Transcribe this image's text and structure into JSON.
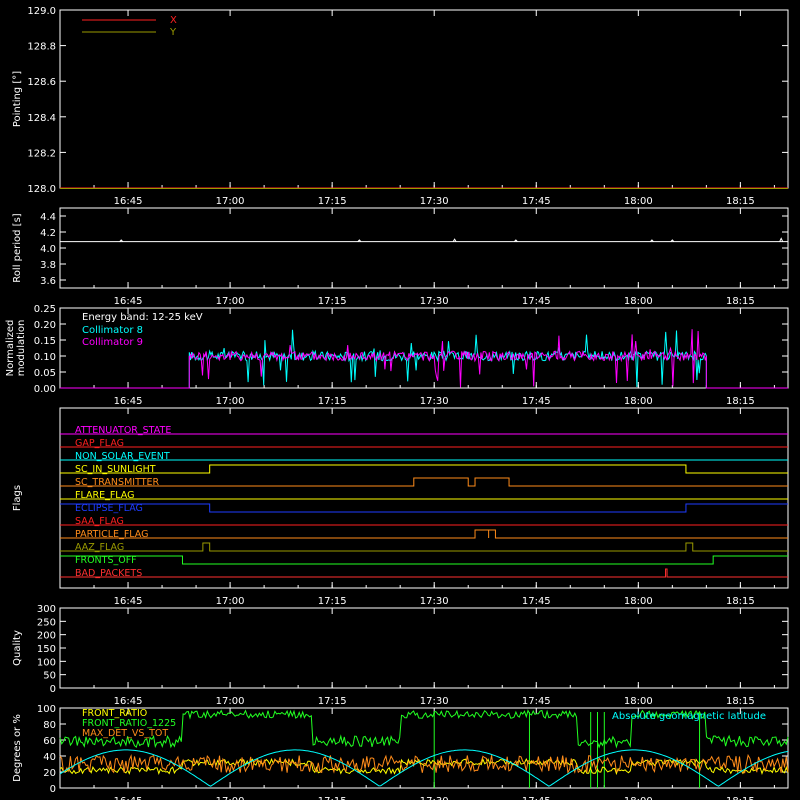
{
  "colors": {
    "background": "#000000",
    "axis": "#ffffff",
    "red": "#ff2020",
    "olive": "#9a9a00",
    "cyan": "#00ffff",
    "magenta": "#ff00ff",
    "yellow": "#ffff00",
    "orange": "#ff8c1a",
    "blue": "#1e3cff",
    "green": "#22ff22",
    "dark_red": "#ff3030"
  },
  "time_axis": {
    "start": "16:35",
    "end": "18:22",
    "ticks": [
      "16:45",
      "17:00",
      "17:15",
      "17:30",
      "17:45",
      "18:00",
      "18:15"
    ]
  },
  "chart_data": [
    {
      "type": "line",
      "id": "pointing",
      "ylabel": "Pointing [°]",
      "ylim": [
        128.0,
        129.0
      ],
      "yticks": [
        "128.0",
        "128.2",
        "128.4",
        "128.6",
        "128.8",
        "129.0"
      ],
      "legend_position": "top-left",
      "series": [
        {
          "name": "X",
          "color": "#ff2020",
          "constant": 128.0
        },
        {
          "name": "Y",
          "color": "#9a9a00",
          "constant": 128.0
        }
      ]
    },
    {
      "type": "line",
      "id": "roll",
      "ylabel": "Roll period [s]",
      "ylim": [
        3.5,
        4.5
      ],
      "yticks": [
        "3.6",
        "3.8",
        "4.0",
        "4.2",
        "4.4"
      ],
      "series": [
        {
          "name": "",
          "color": "#ffffff",
          "constant": 4.08,
          "blips": [
            [
              "16:44",
              4.1
            ],
            [
              "17:19",
              4.1
            ],
            [
              "17:33",
              4.11
            ],
            [
              "17:42",
              4.1
            ],
            [
              "18:02",
              4.1
            ],
            [
              "18:05",
              4.1
            ],
            [
              "18:21",
              4.12
            ]
          ]
        }
      ]
    },
    {
      "type": "line",
      "id": "modulation",
      "ylabel": "Normalized modulation",
      "ylim": [
        0.0,
        0.25
      ],
      "yticks": [
        "0.00",
        "0.05",
        "0.10",
        "0.15",
        "0.20",
        "0.25"
      ],
      "legend_title": "Energy band: 12-25 keV",
      "legend_position": "top-left",
      "active_range": [
        "16:54",
        "18:10"
      ],
      "series": [
        {
          "name": "Collimator 8",
          "color": "#00ffff",
          "level": 0.1
        },
        {
          "name": "Collimator 9",
          "color": "#ff00ff",
          "level": 0.1
        }
      ]
    },
    {
      "type": "line",
      "id": "flags",
      "ylabel": "Flags",
      "rows": [
        {
          "name": "ATTENUATOR_STATE",
          "color": "#ff00ff",
          "segments": []
        },
        {
          "name": "GAP_FLAG",
          "color": "#ff2020",
          "segments": []
        },
        {
          "name": "NON_SOLAR_EVENT",
          "color": "#00ffff",
          "segments": []
        },
        {
          "name": "SC_IN_SUNLIGHT",
          "color": "#ffff00",
          "segments": [
            [
              "16:57",
              "18:07"
            ]
          ]
        },
        {
          "name": "SC_TRANSMITTER",
          "color": "#ff8c1a",
          "segments": [
            [
              "17:27",
              "17:35"
            ],
            [
              "17:36",
              "17:41"
            ]
          ]
        },
        {
          "name": "FLARE_FLAG",
          "color": "#ffff00",
          "segments": []
        },
        {
          "name": "ECLIPSE_FLAG",
          "color": "#1e3cff",
          "segments": [
            [
              "16:35",
              "16:57"
            ],
            [
              "18:07",
              "18:22"
            ]
          ]
        },
        {
          "name": "SAA_FLAG",
          "color": "#ff2020",
          "segments": []
        },
        {
          "name": "PARTICLE_FLAG",
          "color": "#ff8c1a",
          "segments": [
            [
              "17:36",
              "17:38"
            ],
            [
              "17:38",
              "17:39"
            ]
          ]
        },
        {
          "name": "AAZ_FLAG",
          "color": "#9a9a00",
          "segments": [
            [
              "16:56",
              "16:57"
            ],
            [
              "18:07",
              "18:08"
            ]
          ]
        },
        {
          "name": "FRONTS_OFF",
          "color": "#22ff22",
          "segments": [
            [
              "16:35",
              "16:53"
            ],
            [
              "18:11",
              "18:22"
            ]
          ]
        },
        {
          "name": "BAD_PACKETS",
          "color": "#ff3030",
          "segments": [
            [
              "18:04",
              "18:04"
            ]
          ]
        }
      ]
    },
    {
      "type": "line",
      "id": "quality",
      "ylabel": "Quality",
      "ylim": [
        0,
        300
      ],
      "yticks": [
        "0",
        "50",
        "100",
        "150",
        "200",
        "250",
        "300"
      ],
      "series": []
    },
    {
      "type": "line",
      "id": "geomag",
      "ylabel": "Degrees or %",
      "ylim": [
        0,
        100
      ],
      "yticks": [
        "0",
        "20",
        "40",
        "60",
        "80",
        "100"
      ],
      "annotation": "Absolute geomagnetic latitude",
      "legend_position": "top-left",
      "series": [
        {
          "name": "FRONT_RATIO",
          "color": "#ffff00"
        },
        {
          "name": "FRONT_RATIO_1225",
          "color": "#22ff22"
        },
        {
          "name": "MAX_DET_VS_TOT",
          "color": "#ff8c1a"
        },
        {
          "name": "Absolute geomagnetic latitude",
          "color": "#00ffff"
        }
      ]
    }
  ]
}
